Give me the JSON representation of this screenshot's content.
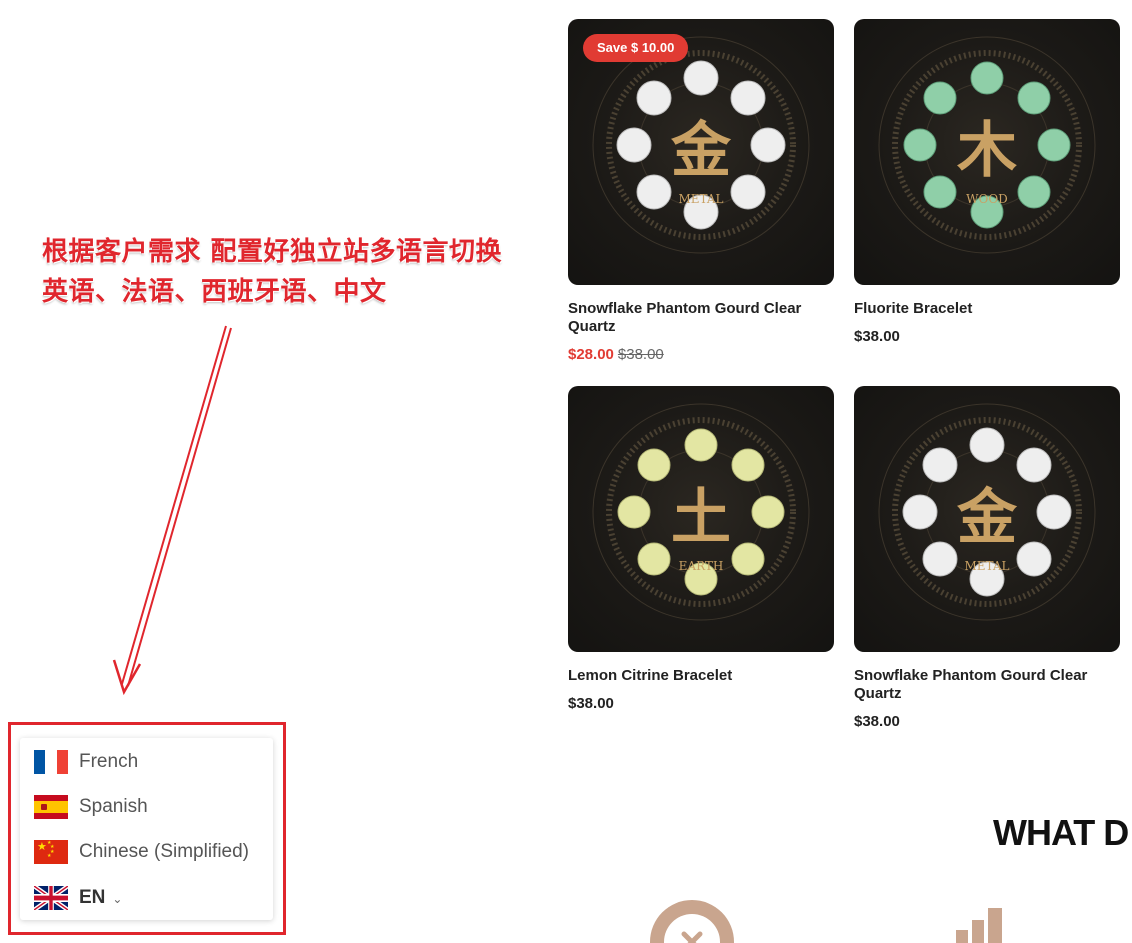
{
  "annotation": {
    "line1": "根据客户需求 配置好独立站多语言切换",
    "line2": "英语、法语、西班牙语、中文"
  },
  "language_switcher": {
    "options": [
      {
        "label": "French",
        "flag": "flag-france-icon"
      },
      {
        "label": "Spanish",
        "flag": "flag-spain-icon"
      },
      {
        "label": "Chinese (Simplified)",
        "flag": "flag-china-icon"
      }
    ],
    "current": {
      "label": "EN",
      "flag": "flag-uk-icon",
      "chevron": "chevron-down-icon"
    }
  },
  "products": [
    {
      "title": "Snowflake Phantom Gourd Clear Quartz",
      "badge": "Save $ 10.00",
      "price": "$28.00",
      "compare_price": "$38.00",
      "emblem_char": "金",
      "emblem_word": "METAL"
    },
    {
      "title": "Fluorite Bracelet",
      "price": "$38.00",
      "emblem_char": "木",
      "emblem_word": "WOOD"
    },
    {
      "title": "Lemon Citrine Bracelet",
      "price": "$38.00",
      "emblem_char": "土",
      "emblem_word": "EARTH"
    },
    {
      "title": "Snowflake Phantom Gourd Clear Quartz",
      "price": "$38.00",
      "emblem_char": "金",
      "emblem_word": "METAL"
    }
  ],
  "section": {
    "heading": "WHAT D"
  },
  "colors": {
    "accent_red": "#e13b33",
    "annotation_red": "#e0262d",
    "emblem_gold": "#c9a164",
    "card_bg": "#1b1916"
  }
}
